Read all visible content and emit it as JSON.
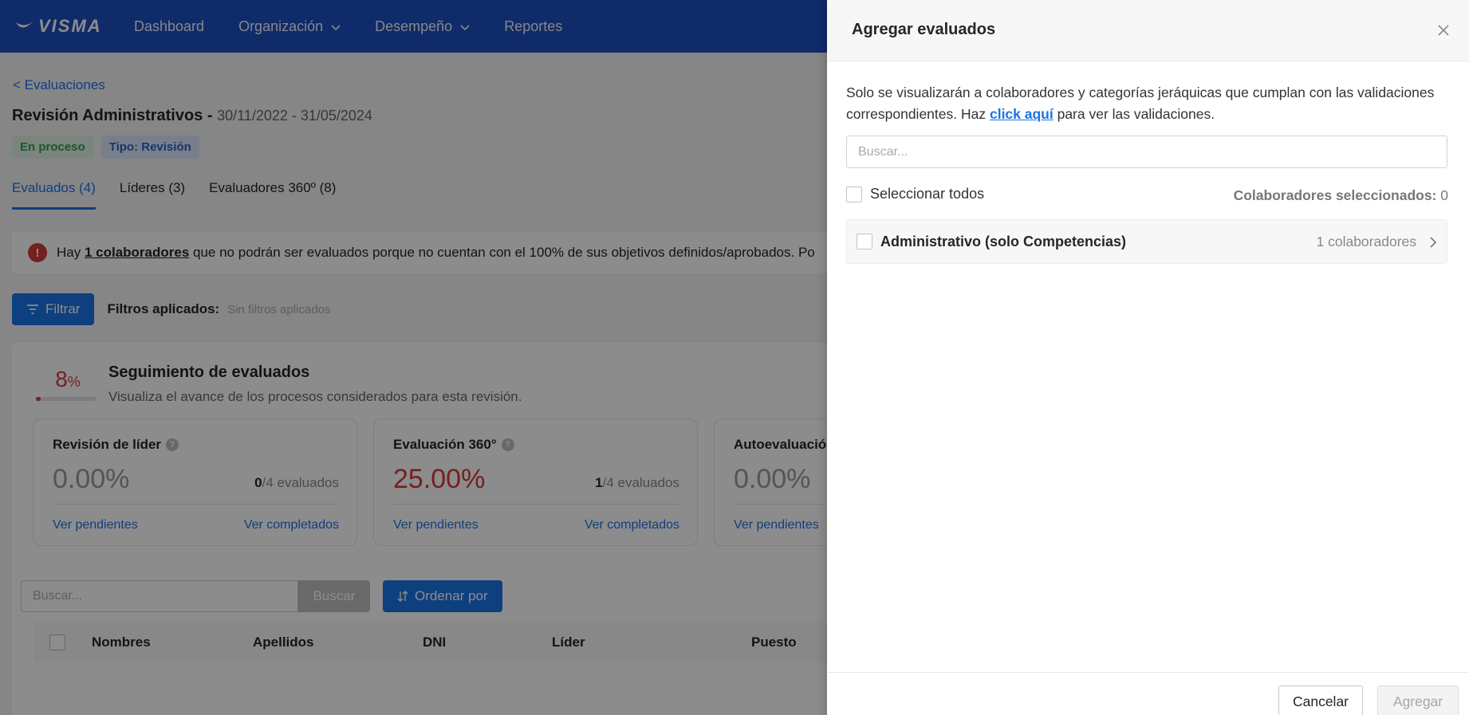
{
  "nav": {
    "logo": "VISMA",
    "items": [
      {
        "label": "Dashboard",
        "has_dropdown": false
      },
      {
        "label": "Organización",
        "has_dropdown": true
      },
      {
        "label": "Desempeño",
        "has_dropdown": true
      },
      {
        "label": "Reportes",
        "has_dropdown": false
      }
    ]
  },
  "page": {
    "back_link": "< Evaluaciones",
    "title": "Revisión Administrativos",
    "title_sep": " - ",
    "dates": "30/11/2022 - 31/05/2024",
    "badges": [
      "En proceso",
      "Tipo: Revisión"
    ],
    "tabs": [
      "Evaluados (4)",
      "Líderes (3)",
      "Evaluadores 360º (8)"
    ],
    "alert": {
      "prefix": "Hay ",
      "link": "1 colaboradores",
      "suffix": " que no podrán ser evaluados porque no cuentan con el 100% de sus objetivos definidos/aprobados. Po"
    },
    "filter_button": "Filtrar",
    "filters_label": "Filtros aplicados:",
    "filters_value": "Sin filtros aplicados",
    "tracking": {
      "percent": "8",
      "percent_unit": "%",
      "progress": 0.08,
      "title": "Seguimiento de evaluados",
      "subtitle": "Visualiza el avance de los procesos considerados para esta revisión."
    },
    "cards": [
      {
        "title": "Revisión de líder",
        "pct": "0.00%",
        "done": "0",
        "total": "/4 evaluados",
        "link1": "Ver pendientes",
        "link2": "Ver completados"
      },
      {
        "title": "Evaluación 360°",
        "pct": "25.00%",
        "done": "1",
        "total": "/4 evaluados",
        "link1": "Ver pendientes",
        "link2": "Ver completados"
      },
      {
        "title": "Autoevaluación",
        "pct": "0.00%",
        "done": "",
        "total": "",
        "link1": "Ver pendientes",
        "link2": ""
      }
    ],
    "search_placeholder": "Buscar...",
    "search_button": "Buscar",
    "sort_button": "Ordenar por",
    "table_headers": [
      "Nombres",
      "Apellidos",
      "DNI",
      "Líder",
      "Puesto"
    ]
  },
  "drawer": {
    "title": "Agregar evaluados",
    "info_prefix": "Solo se visualizarán a colaboradores y categorías jeráquicas que cumplan con las validaciones correspondientes. Haz ",
    "info_link": "click aquí",
    "info_suffix": " para ver las validaciones.",
    "search_placeholder": "Buscar...",
    "select_all": "Seleccionar todos",
    "selected_label": "Colaboradores seleccionados:",
    "selected_count": "0",
    "groups": [
      {
        "name": "Administrativo (solo Competencias)",
        "count": "1 colaboradores"
      }
    ],
    "cancel": "Cancelar",
    "add": "Agregar"
  },
  "colors": {
    "nav_bg": "#1e4fc2",
    "accent": "#1a73e8",
    "danger": "#d33b3b"
  }
}
